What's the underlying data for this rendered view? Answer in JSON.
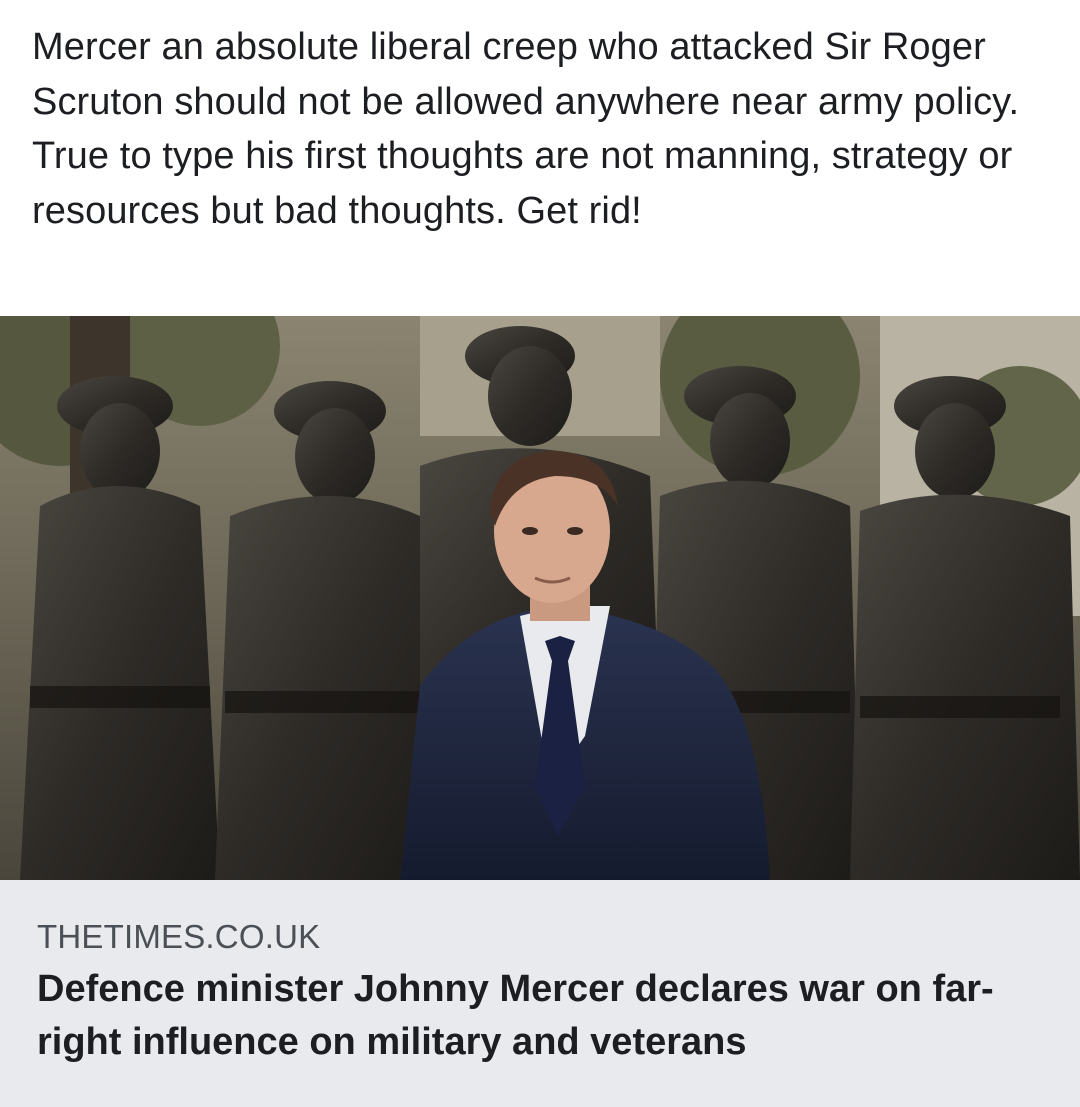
{
  "post": {
    "text": "Mercer an absolute liberal creep who attacked Sir Roger Scruton should not be allowed anywhere near army policy. True to type his first thoughts are not manning, strategy or resources but bad thoughts. Get rid!"
  },
  "link_preview": {
    "image_icon": "photo-statues-and-man-in-suit",
    "domain": "THETIMES.CO.UK",
    "title": "Defence minister Johnny Mercer declares war on far-right influence on military and veterans"
  },
  "colors": {
    "text": "#1c1e21",
    "domain_text": "#4b4f56",
    "card_background": "#e9eaee"
  }
}
